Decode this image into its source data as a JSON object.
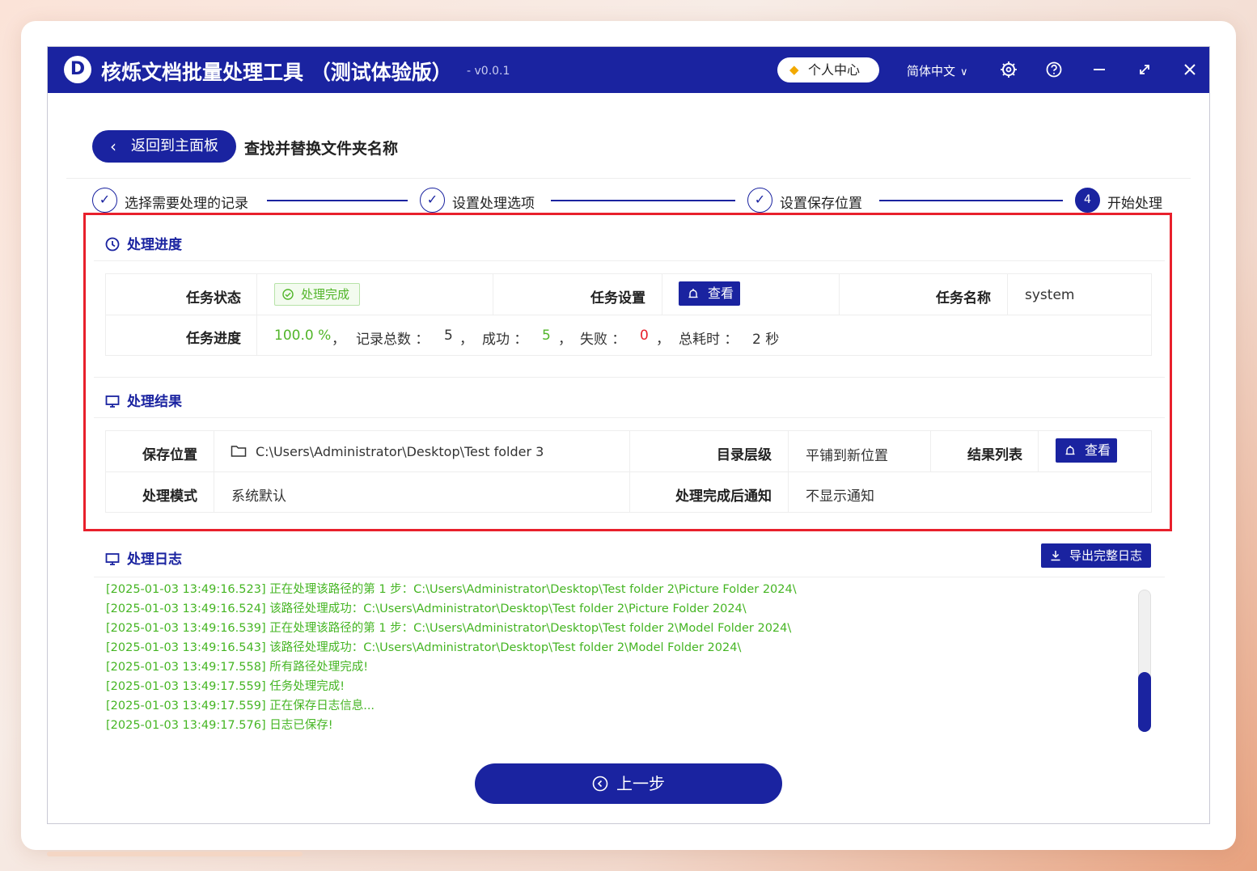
{
  "app": {
    "logo_letter": "D",
    "title": "核烁文档批量处理工具 （测试体验版）",
    "version": "- v0.0.1",
    "user_center": "个人中心",
    "language": "简体中文"
  },
  "header": {
    "back_label": "返回到主面板",
    "page_title": "查找并替换文件夹名称"
  },
  "steps": [
    {
      "label": "选择需要处理的记录",
      "state": "done"
    },
    {
      "label": "设置处理选项",
      "state": "done"
    },
    {
      "label": "设置保存位置",
      "state": "done"
    },
    {
      "label": "开始处理",
      "state": "active",
      "number": "4"
    }
  ],
  "progress": {
    "title": "处理进度",
    "task_status_label": "任务状态",
    "task_status_value": "处理完成",
    "task_settings_label": "任务设置",
    "view_label": "查看",
    "task_name_label": "任务名称",
    "task_name_value": "system",
    "task_progress_label": "任务进度",
    "percent": "100.0 %",
    "sep": "，",
    "total_label": "记录总数 ：",
    "total_value": "5",
    "success_label": "成功 ：",
    "success_value": "5",
    "fail_label": "失败 ：",
    "fail_value": "0",
    "time_label": "总耗时 ：",
    "time_value": "2 秒"
  },
  "result": {
    "title": "处理结果",
    "save_location_label": "保存位置",
    "save_location_value": "C:\\Users\\Administrator\\Desktop\\Test folder 3",
    "dir_level_label": "目录层级",
    "dir_level_value": "平铺到新位置",
    "result_list_label": "结果列表",
    "view_label": "查看",
    "mode_label": "处理模式",
    "mode_value": "系统默认",
    "notify_label": "处理完成后通知",
    "notify_value": "不显示通知"
  },
  "log": {
    "title": "处理日志",
    "export_label": "导出完整日志",
    "lines": [
      "[2025-01-03 13:49:16.523] 正在处理该路径的第 1 步：C:\\Users\\Administrator\\Desktop\\Test folder 2\\Picture Folder 2024\\",
      "[2025-01-03 13:49:16.524] 该路径处理成功：C:\\Users\\Administrator\\Desktop\\Test folder 2\\Picture Folder 2024\\",
      "[2025-01-03 13:49:16.539] 正在处理该路径的第 1 步：C:\\Users\\Administrator\\Desktop\\Test folder 2\\Model Folder 2024\\",
      "[2025-01-03 13:49:16.543] 该路径处理成功：C:\\Users\\Administrator\\Desktop\\Test folder 2\\Model Folder 2024\\",
      "[2025-01-03 13:49:17.558] 所有路径处理完成!",
      "[2025-01-03 13:49:17.559] 任务处理完成!",
      "[2025-01-03 13:49:17.559] 正在保存日志信息...",
      "[2025-01-03 13:49:17.576] 日志已保存!"
    ]
  },
  "footer": {
    "prev_label": "上一步"
  },
  "colors": {
    "primary": "#1a23a0",
    "success": "#52b52a",
    "danger": "#e8202c"
  }
}
